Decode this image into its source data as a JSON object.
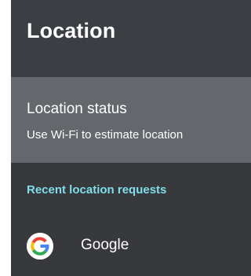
{
  "header": {
    "title": "Location"
  },
  "location_status": {
    "title": "Location status",
    "subtitle": "Use Wi-Fi to estimate location"
  },
  "recent_requests": {
    "section_title": "Recent location requests",
    "items": [
      {
        "app_name": "Google",
        "icon": "google-icon"
      }
    ]
  },
  "colors": {
    "background": "#37393c",
    "header": "#3b3e43",
    "selected_card": "#64676b",
    "accent": "#80deea",
    "text": "#ffffff"
  }
}
